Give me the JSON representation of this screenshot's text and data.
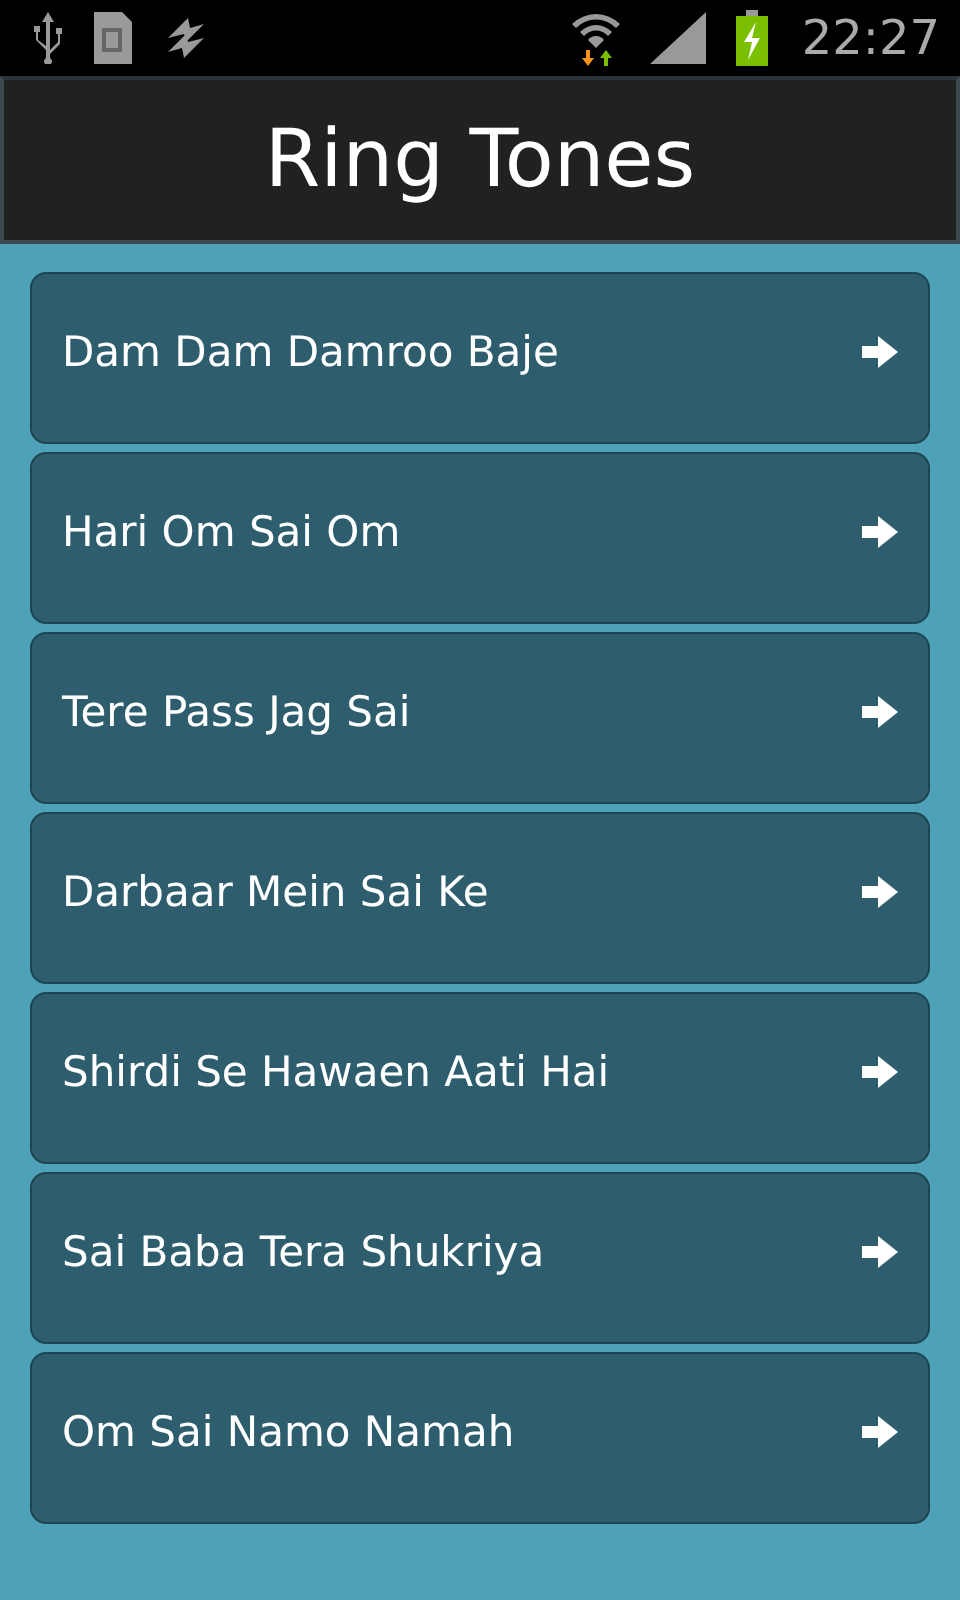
{
  "status_bar": {
    "time": "22:27"
  },
  "header": {
    "title": "Ring Tones"
  },
  "items": [
    {
      "label": "Dam Dam Damroo Baje"
    },
    {
      "label": "Hari Om Sai Om"
    },
    {
      "label": "Tere Pass Jag Sai"
    },
    {
      "label": "Darbaar Mein Sai Ke"
    },
    {
      "label": "Shirdi Se Hawaen Aati Hai"
    },
    {
      "label": "Sai Baba Tera Shukriya"
    },
    {
      "label": "Om Sai Namo Namah"
    }
  ]
}
